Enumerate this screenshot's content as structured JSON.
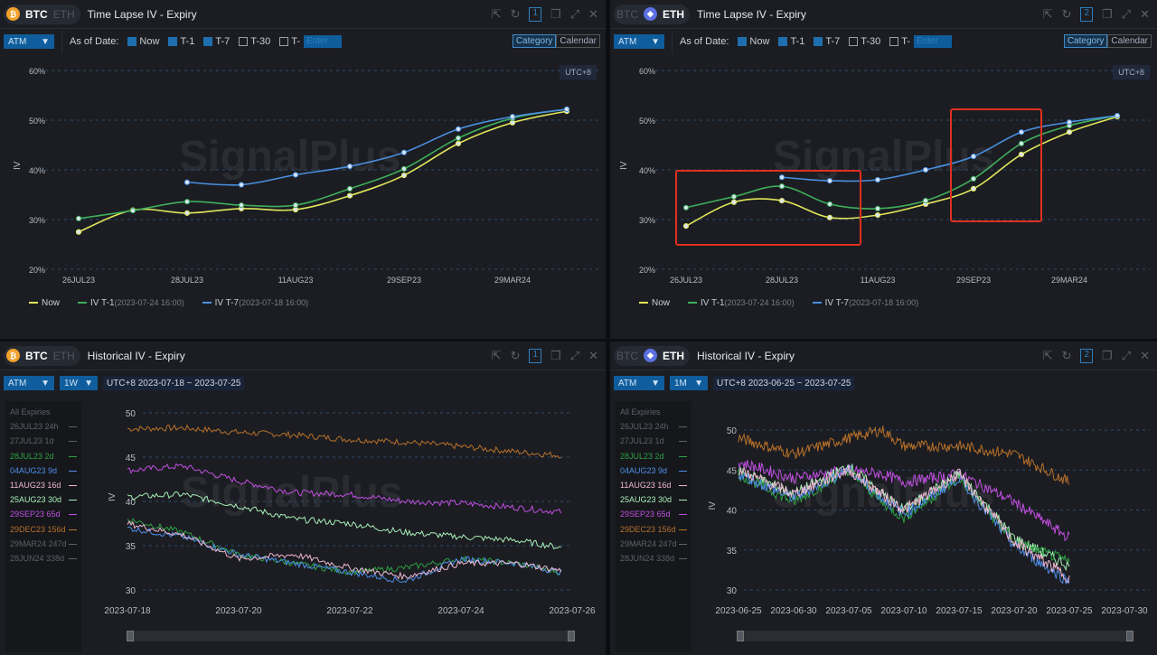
{
  "panels": [
    {
      "coin_active": "BTC",
      "coin_inactive": "ETH",
      "title": "Time Lapse IV - Expiry",
      "panel_num": "1",
      "mode": "ATM",
      "as_of_label": "As of Date:",
      "checks": [
        {
          "label": "Now",
          "checked": true
        },
        {
          "label": "T-1",
          "checked": true
        },
        {
          "label": "T-7",
          "checked": true
        },
        {
          "label": "T-30",
          "checked": false
        },
        {
          "label": "T-",
          "checked": false
        }
      ],
      "enter_placeholder": "Enter",
      "seg": [
        "Category",
        "Calendar"
      ],
      "tz": "UTC+8"
    },
    {
      "coin_active": "ETH",
      "coin_inactive": "BTC",
      "title": "Time Lapse IV - Expiry",
      "panel_num": "2",
      "mode": "ATM",
      "as_of_label": "As of Date:",
      "checks": [
        {
          "label": "Now",
          "checked": true
        },
        {
          "label": "T-1",
          "checked": true
        },
        {
          "label": "T-7",
          "checked": true
        },
        {
          "label": "T-30",
          "checked": false
        },
        {
          "label": "T-",
          "checked": false
        }
      ],
      "enter_placeholder": "Enter",
      "seg": [
        "Category",
        "Calendar"
      ],
      "tz": "UTC+8"
    },
    {
      "coin_active": "BTC",
      "coin_inactive": "ETH",
      "title": "Historical IV - Expiry",
      "panel_num": "1",
      "mode": "ATM",
      "period": "1W",
      "range": "UTC+8 2023-07-18 ~ 2023-07-25"
    },
    {
      "coin_active": "ETH",
      "coin_inactive": "BTC",
      "title": "Historical IV - Expiry",
      "panel_num": "2",
      "mode": "ATM",
      "period": "1M",
      "range": "UTC+8 2023-06-25 ~ 2023-07-25"
    }
  ],
  "watermark": "SignalPlus",
  "expiries_header": "All Expiries",
  "expiries": [
    {
      "label": "26JUL23 24h",
      "color": "#5d6168"
    },
    {
      "label": "27JUL23 1d",
      "color": "#5d6168"
    },
    {
      "label": "28JUL23 2d",
      "color": "#2ea043"
    },
    {
      "label": "04AUG23 9d",
      "color": "#4f8de8"
    },
    {
      "label": "11AUG23 16d",
      "color": "#f0b6d0"
    },
    {
      "label": "25AUG23 30d",
      "color": "#a8f0b8"
    },
    {
      "label": "29SEP23 65d",
      "color": "#c04ee0"
    },
    {
      "label": "29DEC23 156d",
      "color": "#b8702a"
    },
    {
      "label": "29MAR24 247d",
      "color": "#5d6168"
    },
    {
      "label": "28JUN24 338d",
      "color": "#5d6168"
    }
  ],
  "chart_data": [
    {
      "type": "line",
      "title": "BTC Time Lapse IV - Expiry",
      "ylabel": "IV",
      "ylim": [
        20,
        60
      ],
      "yticks": [
        "20%",
        "30%",
        "40%",
        "50%",
        "60%"
      ],
      "categories": [
        "26JUL23",
        "27JUL23",
        "28JUL23",
        "04AUG23",
        "11AUG23",
        "25AUG23",
        "29SEP23",
        "29DEC23",
        "29MAR24",
        "28JUN24"
      ],
      "xtick_labels": [
        "26JUL23",
        "28JUL23",
        "11AUG23",
        "29SEP23",
        "29MAR24"
      ],
      "series": [
        {
          "name": "Now",
          "detail": "",
          "color": "#e2e65a",
          "values": [
            27.5,
            31.9,
            31.3,
            32.2,
            32.0,
            34.8,
            38.9,
            45.3,
            49.5,
            51.8
          ]
        },
        {
          "name": "IV T-1",
          "detail": "(2023-07-24 16:00)",
          "color": "#3fae5a",
          "values": [
            30.2,
            31.8,
            33.6,
            32.9,
            32.9,
            36.2,
            40.2,
            46.4,
            50.4,
            52.2
          ]
        },
        {
          "name": "IV T-7",
          "detail": "(2023-07-18 16:00)",
          "color": "#4a8fe0",
          "values": [
            null,
            null,
            37.5,
            37.0,
            39.0,
            40.7,
            43.5,
            48.2,
            50.7,
            52.2
          ]
        }
      ]
    },
    {
      "type": "line",
      "title": "ETH Time Lapse IV - Expiry",
      "ylabel": "IV",
      "ylim": [
        20,
        60
      ],
      "yticks": [
        "20%",
        "30%",
        "40%",
        "50%",
        "60%"
      ],
      "categories": [
        "26JUL23",
        "27JUL23",
        "28JUL23",
        "04AUG23",
        "11AUG23",
        "25AUG23",
        "29SEP23",
        "29DEC23",
        "29MAR24",
        "28JUN24"
      ],
      "xtick_labels": [
        "26JUL23",
        "28JUL23",
        "11AUG23",
        "29SEP23",
        "29MAR24"
      ],
      "series": [
        {
          "name": "Now",
          "detail": "",
          "color": "#e2e65a",
          "values": [
            28.7,
            33.5,
            33.8,
            30.4,
            30.9,
            33.1,
            36.2,
            43.1,
            47.6,
            50.7
          ]
        },
        {
          "name": "IV T-1",
          "detail": "(2023-07-24 16:00)",
          "color": "#3fae5a",
          "values": [
            32.4,
            34.6,
            36.7,
            33.1,
            32.2,
            33.8,
            38.2,
            45.3,
            48.9,
            50.9
          ]
        },
        {
          "name": "IV T-7",
          "detail": "(2023-07-18 16:00)",
          "color": "#4a8fe0",
          "values": [
            null,
            null,
            38.5,
            37.8,
            38.0,
            40.0,
            42.7,
            47.6,
            49.6,
            50.9
          ]
        }
      ]
    },
    {
      "type": "line",
      "title": "BTC Historical IV - Expiry",
      "ylabel": "IV",
      "ylim": [
        30,
        50
      ],
      "yticks": [
        "30",
        "35",
        "40",
        "45",
        "50"
      ],
      "xtick_labels": [
        "2023-07-18",
        "2023-07-20",
        "2023-07-22",
        "2023-07-24",
        "2023-07-26"
      ],
      "x_days": [
        0,
        1,
        2,
        3,
        4,
        5,
        6,
        7,
        7.8
      ],
      "series": [
        {
          "name": "29DEC23 156d",
          "color": "#b8702a",
          "values": [
            48.2,
            48.3,
            47.8,
            47.5,
            47.0,
            46.7,
            46.2,
            45.6,
            45.2
          ]
        },
        {
          "name": "29SEP23 65d",
          "color": "#c04ee0",
          "values": [
            43.5,
            44.0,
            42.3,
            41.0,
            40.8,
            40.0,
            39.8,
            39.3,
            38.8
          ]
        },
        {
          "name": "25AUG23 30d",
          "color": "#a8f0b8",
          "values": [
            40.5,
            40.8,
            39.5,
            38.0,
            37.5,
            36.5,
            36.0,
            35.6,
            34.8
          ]
        },
        {
          "name": "28JUL23 2d",
          "color": "#2ea043",
          "values": [
            38.0,
            36.5,
            34.0,
            33.0,
            32.0,
            32.5,
            33.5,
            33.0,
            32.0
          ]
        },
        {
          "name": "04AUG23 9d",
          "color": "#4f8de8",
          "values": [
            37.0,
            36.0,
            34.0,
            33.0,
            32.0,
            31.0,
            33.5,
            33.0,
            32.0
          ]
        },
        {
          "name": "11AUG23 16d",
          "color": "#f0b6d0",
          "values": [
            37.5,
            36.2,
            33.5,
            34.0,
            32.5,
            31.5,
            33.0,
            33.0,
            32.2
          ]
        }
      ]
    },
    {
      "type": "line",
      "title": "ETH Historical IV - Expiry",
      "ylabel": "IV",
      "ylim": [
        30,
        50
      ],
      "yticks": [
        "30",
        "35",
        "40",
        "45",
        "50"
      ],
      "xtick_labels": [
        "2023-06-25",
        "2023-06-30",
        "2023-07-05",
        "2023-07-10",
        "2023-07-15",
        "2023-07-20",
        "2023-07-25",
        "2023-07-30"
      ],
      "x_days": [
        0,
        5,
        10,
        13,
        15,
        20,
        25,
        30
      ],
      "series": [
        {
          "name": "29DEC23 156d",
          "color": "#b8702a",
          "values": [
            49.0,
            47.0,
            49.0,
            50.0,
            48.0,
            48.0,
            47.0,
            43.5
          ]
        },
        {
          "name": "29SEP23 65d",
          "color": "#c04ee0",
          "values": [
            46.0,
            44.0,
            45.0,
            44.5,
            43.5,
            44.5,
            41.0,
            36.5
          ]
        },
        {
          "name": "25AUG23 30d",
          "color": "#a8f0b8",
          "values": [
            45.0,
            42.0,
            45.5,
            42.0,
            40.0,
            44.5,
            36.5,
            33.0
          ]
        },
        {
          "name": "28JUL23 2d",
          "color": "#2ea043",
          "values": [
            44.5,
            41.0,
            45.0,
            41.0,
            39.0,
            44.0,
            36.0,
            33.5
          ]
        },
        {
          "name": "04AUG23 9d",
          "color": "#4f8de8",
          "values": [
            44.5,
            41.5,
            45.0,
            41.5,
            39.5,
            44.0,
            35.5,
            31.0
          ]
        },
        {
          "name": "11AUG23 16d",
          "color": "#f0b6d0",
          "values": [
            45.0,
            42.0,
            45.0,
            42.0,
            40.0,
            44.5,
            36.0,
            31.5
          ]
        }
      ]
    }
  ]
}
